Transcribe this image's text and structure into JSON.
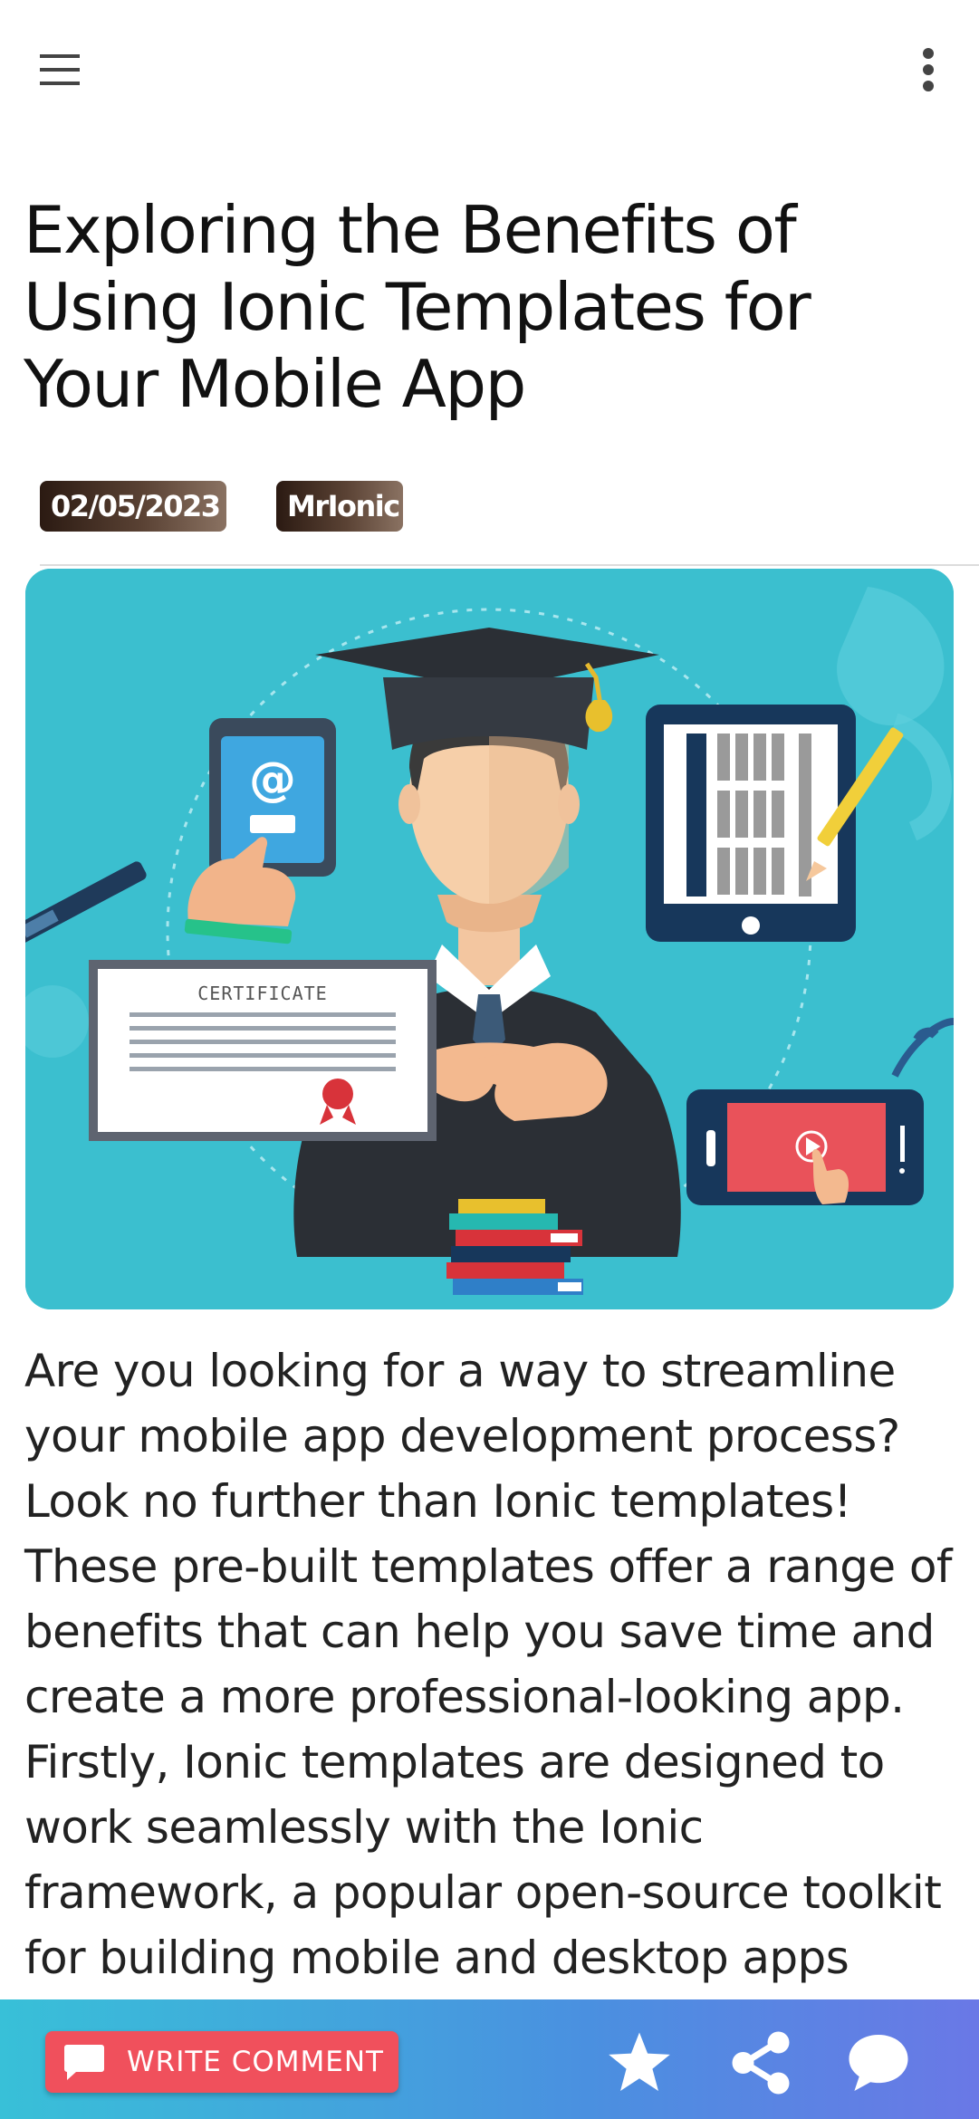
{
  "toolbar": {
    "menu_icon": "menu-icon",
    "more_icon": "more-vertical-icon"
  },
  "article": {
    "title": "Exploring the Benefits of Using Ionic Templates for Your Mobile App",
    "date": "02/05/2023",
    "author": "MrIonic",
    "image": {
      "certificate_text": "CERTIFICATE"
    },
    "body": "Are you looking for a way to streamline your mobile app development process? Look no further than Ionic templates! These pre-built templates offer a range of benefits that can help you save time and create a more professional-looking app. Firstly, Ionic templates are designed to work seamlessly with the Ionic framework, a popular open-source toolkit for building mobile and desktop apps using web technologies like HTML, CSS"
  },
  "footer": {
    "write_comment_label": "WRITE COMMENT",
    "icons": [
      "comment-icon",
      "star-icon",
      "share-icon",
      "chat-icon"
    ]
  },
  "colors": {
    "badge_dark": "#2b1a12",
    "hero_bg": "#3bbfcf",
    "write_button": "#f0505c",
    "footer_start": "#38c0d8",
    "footer_end": "#6a78e6"
  }
}
